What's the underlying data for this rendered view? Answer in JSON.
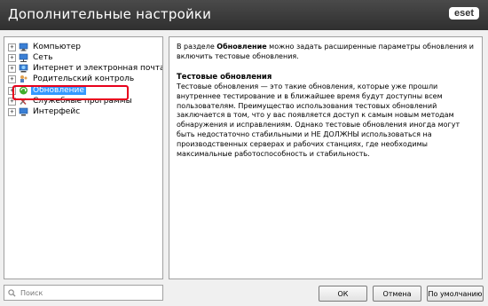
{
  "window": {
    "title": "Дополнительные настройки",
    "logo": "eset"
  },
  "tree": {
    "items": [
      {
        "label": "Компьютер",
        "icon": "computer-icon",
        "expanded": false
      },
      {
        "label": "Сеть",
        "icon": "network-icon",
        "expanded": false
      },
      {
        "label": "Интернет и электронная почта",
        "icon": "globe-icon",
        "expanded": false
      },
      {
        "label": "Родительский контроль",
        "icon": "parental-control-icon",
        "expanded": false
      },
      {
        "label": "Обновление",
        "icon": "update-icon",
        "expanded": false,
        "selected": true
      },
      {
        "label": "Служебные программы",
        "icon": "tools-icon",
        "expanded": false
      },
      {
        "label": "Интерфейс",
        "icon": "monitor-icon",
        "expanded": false
      }
    ]
  },
  "detail": {
    "intro_pre": "В разделе ",
    "intro_bold": "Обновление",
    "intro_post": " можно задать расширенные параметры обновления и включить тестовые обновления.",
    "heading": "Тестовые обновления",
    "body": "Тестовые обновления — это такие обновления, которые уже прошли внутреннее тестирование и в ближайшее время будут доступны всем пользователям. Преимущество использования тестовых обновлений заключается в том, что у вас появляется доступ к самым новым методам обнаружения и исправлениям. Однако тестовые обновления иногда могут быть недостаточно стабильными и НЕ ДОЛЖНЫ использоваться на производственных серверах и рабочих станциях, где необходимы максимальные работоспособность и стабильность."
  },
  "search": {
    "placeholder": "Поиск"
  },
  "buttons": {
    "ok": "ОК",
    "cancel": "Отмена",
    "default": "По умолчанию"
  },
  "colors": {
    "selection": "#3399ff",
    "highlight_box": "#e8001c",
    "titlebar": "#3a3a3a"
  }
}
